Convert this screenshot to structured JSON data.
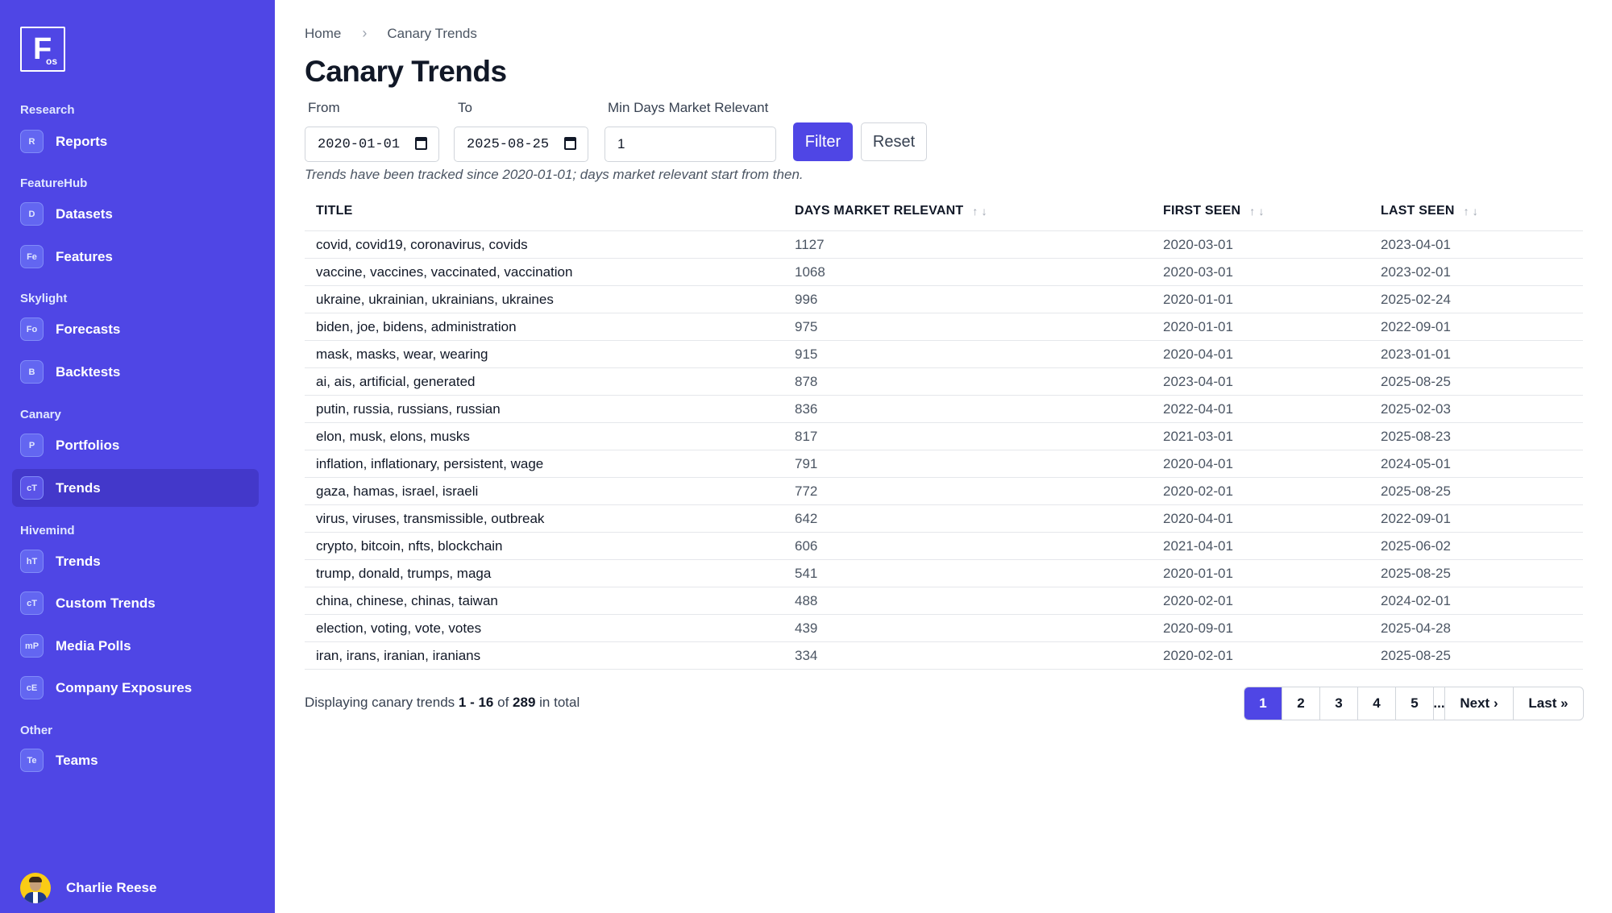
{
  "sidebar": {
    "logo": {
      "big": "F",
      "small": "os"
    },
    "sections": [
      {
        "label": "Research",
        "items": [
          {
            "badge": "R",
            "label": "Reports"
          }
        ]
      },
      {
        "label": "FeatureHub",
        "items": [
          {
            "badge": "D",
            "label": "Datasets"
          },
          {
            "badge": "Fe",
            "label": "Features"
          }
        ]
      },
      {
        "label": "Skylight",
        "items": [
          {
            "badge": "Fo",
            "label": "Forecasts"
          },
          {
            "badge": "B",
            "label": "Backtests"
          }
        ]
      },
      {
        "label": "Canary",
        "items": [
          {
            "badge": "P",
            "label": "Portfolios"
          },
          {
            "badge": "cT",
            "label": "Trends",
            "active": true
          }
        ]
      },
      {
        "label": "Hivemind",
        "items": [
          {
            "badge": "hT",
            "label": "Trends"
          },
          {
            "badge": "cT",
            "label": "Custom Trends"
          },
          {
            "badge": "mP",
            "label": "Media Polls"
          },
          {
            "badge": "cE",
            "label": "Company Exposures"
          }
        ]
      },
      {
        "label": "Other",
        "items": [
          {
            "badge": "Te",
            "label": "Teams"
          }
        ]
      }
    ],
    "user": {
      "name": "Charlie Reese"
    }
  },
  "breadcrumb": {
    "home": "Home",
    "separator": "›",
    "current": "Canary Trends"
  },
  "page_title": "Canary Trends",
  "filters": {
    "from_label": "From",
    "from_value": "2020-01-01",
    "to_label": "To",
    "to_value": "2025-08-25",
    "min_days_label": "Min Days Market Relevant",
    "min_days_value": "1",
    "filter_button": "Filter",
    "reset_button": "Reset"
  },
  "note": "Trends have been tracked since 2020-01-01; days market relevant start from then.",
  "table": {
    "columns": [
      "TITLE",
      "DAYS MARKET RELEVANT",
      "FIRST SEEN",
      "LAST SEEN"
    ],
    "sort_up": "↑",
    "sort_down": "↓",
    "rows": [
      [
        "covid, covid19, coronavirus, covids",
        "1127",
        "2020-03-01",
        "2023-04-01"
      ],
      [
        "vaccine, vaccines, vaccinated, vaccination",
        "1068",
        "2020-03-01",
        "2023-02-01"
      ],
      [
        "ukraine, ukrainian, ukrainians, ukraines",
        "996",
        "2020-01-01",
        "2025-02-24"
      ],
      [
        "biden, joe, bidens, administration",
        "975",
        "2020-01-01",
        "2022-09-01"
      ],
      [
        "mask, masks, wear, wearing",
        "915",
        "2020-04-01",
        "2023-01-01"
      ],
      [
        "ai, ais, artificial, generated",
        "878",
        "2023-04-01",
        "2025-08-25"
      ],
      [
        "putin, russia, russians, russian",
        "836",
        "2022-04-01",
        "2025-02-03"
      ],
      [
        "elon, musk, elons, musks",
        "817",
        "2021-03-01",
        "2025-08-23"
      ],
      [
        "inflation, inflationary, persistent, wage",
        "791",
        "2020-04-01",
        "2024-05-01"
      ],
      [
        "gaza, hamas, israel, israeli",
        "772",
        "2020-02-01",
        "2025-08-25"
      ],
      [
        "virus, viruses, transmissible, outbreak",
        "642",
        "2020-04-01",
        "2022-09-01"
      ],
      [
        "crypto, bitcoin, nfts, blockchain",
        "606",
        "2021-04-01",
        "2025-06-02"
      ],
      [
        "trump, donald, trumps, maga",
        "541",
        "2020-01-01",
        "2025-08-25"
      ],
      [
        "china, chinese, chinas, taiwan",
        "488",
        "2020-02-01",
        "2024-02-01"
      ],
      [
        "election, voting, vote, votes",
        "439",
        "2020-09-01",
        "2025-04-28"
      ],
      [
        "iran, irans, iranian, iranians",
        "334",
        "2020-02-01",
        "2025-08-25"
      ]
    ]
  },
  "summary": {
    "prefix": "Displaying canary trends",
    "range": "1 - 16",
    "of": "of",
    "total": "289",
    "suffix": "in total"
  },
  "pagination": {
    "pages": [
      "1",
      "2",
      "3",
      "4",
      "5"
    ],
    "active": "1",
    "ellipsis": "...",
    "next": "Next ›",
    "last": "Last »"
  }
}
